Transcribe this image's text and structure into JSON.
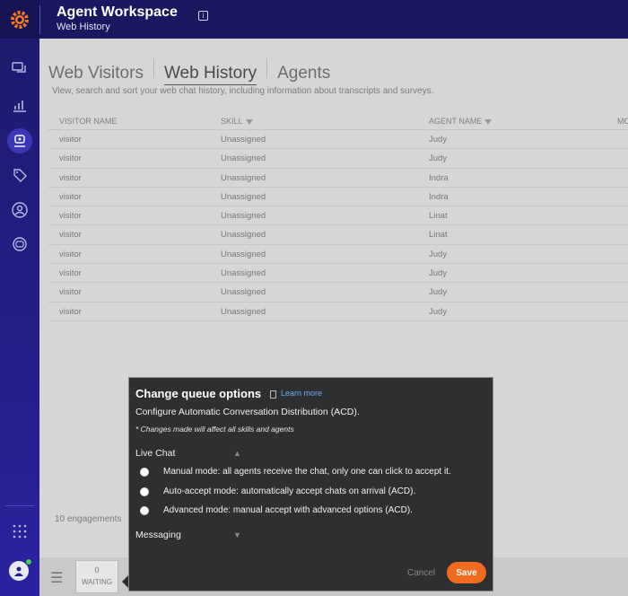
{
  "header": {
    "title": "Agent Workspace",
    "subtitle": "Web History"
  },
  "tabs": [
    {
      "label": "Web Visitors"
    },
    {
      "label": "Web History"
    },
    {
      "label": "Agents"
    }
  ],
  "page_description": "View, search and sort your web chat history, including information about transcripts and surveys.",
  "table": {
    "columns": [
      "VISITOR NAME",
      "SKILL",
      "AGENT NAME",
      "MC"
    ],
    "rows": [
      [
        "visitor",
        "Unassigned",
        "Judy"
      ],
      [
        "visitor",
        "Unassigned",
        "Judy"
      ],
      [
        "visitor",
        "Unassigned",
        "Indra"
      ],
      [
        "visitor",
        "Unassigned",
        "Indra"
      ],
      [
        "visitor",
        "Unassigned",
        "Linat"
      ],
      [
        "visitor",
        "Unassigned",
        "Linat"
      ],
      [
        "visitor",
        "Unassigned",
        "Judy"
      ],
      [
        "visitor",
        "Unassigned",
        "Judy"
      ],
      [
        "visitor",
        "Unassigned",
        "Judy"
      ],
      [
        "visitor",
        "Unassigned",
        "Judy"
      ]
    ]
  },
  "engagements": "10 engagements",
  "waiting": {
    "count": "0",
    "label": "WAITING"
  },
  "popup": {
    "title": "Change queue options",
    "learn_more": "Learn more",
    "subtitle": "Configure Automatic Conversation Distribution (ACD).",
    "note": "* Changes made will affect all skills and agents",
    "live_chat_label": "Live Chat",
    "options": [
      "Manual mode: all agents receive the chat, only one can click to accept it.",
      "Auto-accept mode: automatically accept chats on arrival (ACD).",
      "Advanced mode: manual accept with advanced options (ACD)."
    ],
    "messaging_label": "Messaging",
    "cancel": "Cancel",
    "save": "Save"
  },
  "colors": {
    "accent": "#f06a1f",
    "sidebar": "#241e8a",
    "header": "#1b1862",
    "link": "#6aaef0"
  }
}
